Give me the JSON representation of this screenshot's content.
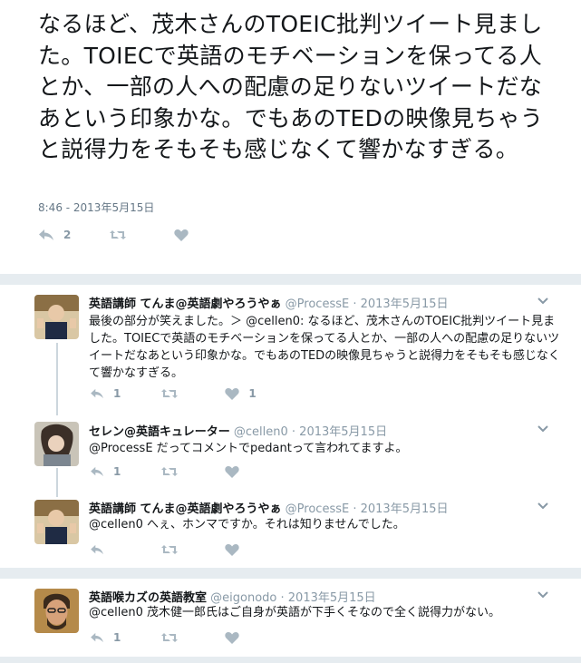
{
  "main_tweet": {
    "text": "なるほど、茂木さんのTOEIC批判ツイート見ました。TOIECで英語のモチベーションを保ってる人とか、一部の人への配慮の足りないツイートだなあという印象かな。でもあのTEDの映像見ちゃうと説得力をそもそも感じなくて響かなすぎる。",
    "timestamp": "8:46 - 2013年5月15日",
    "reply_count": "2"
  },
  "replies": [
    {
      "name": "英語講師 てんま@英語劇やろうやぁ",
      "handle": "@ProcessE",
      "date": "· 2013年5月15日",
      "text": "最後の部分が笑えました。＞ @cellen0: なるほど、茂木さんのTOEIC批判ツイート見ました。TOIECで英語のモチベーションを保ってる人とか、一部の人への配慮の足りないツイートだなあという印象かな。でもあのTEDの映像見ちゃうと説得力をそもそも感じなくて響かなすぎる。",
      "reply_count": "1",
      "like_count": "1"
    },
    {
      "name": "セレン@英語キュレーター",
      "handle": "@cellen0",
      "date": "· 2013年5月15日",
      "text": "@ProcessE だってコメントでpedantって言われてますよ。",
      "reply_count": "1",
      "like_count": ""
    },
    {
      "name": "英語講師 てんま@英語劇やろうやぁ",
      "handle": "@ProcessE",
      "date": "· 2013年5月15日",
      "text": "@cellen0 へぇ、ホンマですか。それは知りませんでした。",
      "reply_count": "",
      "like_count": ""
    },
    {
      "name": "英語喉カズの英語教室",
      "handle": "@eigonodo",
      "date": "· 2013年5月15日",
      "text": "@cellen0 茂木健一郎氏はご自身が英語が下手くそなので全く説得力がない。",
      "reply_count": "1",
      "like_count": ""
    }
  ],
  "icons": {
    "reply": "reply-icon",
    "retweet": "retweet-icon",
    "like": "heart-icon",
    "caret": "chevron-down-icon"
  },
  "colors": {
    "text": "#14171a",
    "meta": "#8899a6",
    "action": "#aab8c2",
    "divider": "#e6ecf0"
  }
}
